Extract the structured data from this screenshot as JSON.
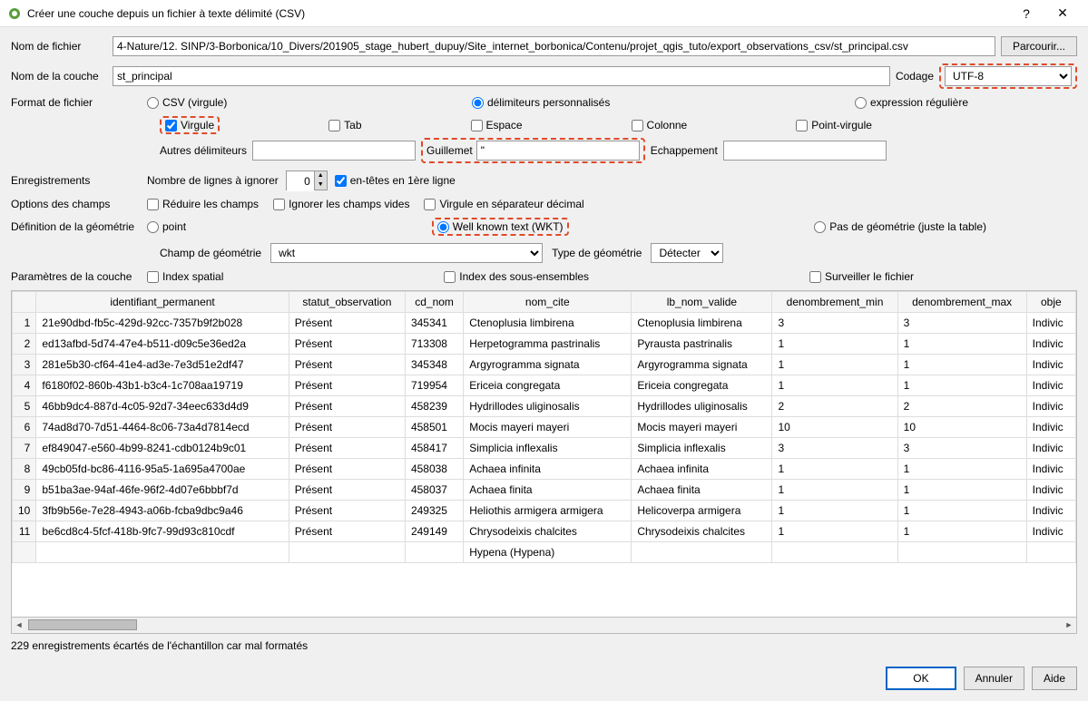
{
  "window": {
    "title": "Créer une couche depuis un fichier à texte délimité (CSV)"
  },
  "file": {
    "label": "Nom de fichier",
    "value": "4-Nature/12. SINP/3-Borbonica/10_Divers/201905_stage_hubert_dupuy/Site_internet_borbonica/Contenu/projet_qgis_tuto/export_observations_csv/st_principal.csv",
    "browse": "Parcourir..."
  },
  "layer": {
    "label": "Nom de la couche",
    "value": "st_principal",
    "encoding_label": "Codage",
    "encoding_value": "UTF-8"
  },
  "format": {
    "label": "Format de fichier",
    "csv": "CSV (virgule)",
    "custom": "délimiteurs personnalisés",
    "regex": "expression régulière"
  },
  "delim": {
    "virgule": "Virgule",
    "tab": "Tab",
    "espace": "Espace",
    "colonne": "Colonne",
    "pv": "Point-virgule",
    "autres": "Autres délimiteurs",
    "guillemet": "Guillemet",
    "guillemet_val": "\"",
    "echap": "Echappement"
  },
  "records": {
    "label": "Enregistrements",
    "skip": "Nombre de lignes à ignorer",
    "skip_val": "0",
    "header": "en-têtes en 1ère ligne"
  },
  "fields": {
    "label": "Options des champs",
    "trim": "Réduire les champs",
    "ignore_empty": "Ignorer les champs vides",
    "decimal": "Virgule en séparateur décimal"
  },
  "geom": {
    "label": "Définition de la géométrie",
    "point": "point",
    "wkt": "Well known text (WKT)",
    "none": "Pas de géométrie (juste la table)",
    "field_label": "Champ de géométrie",
    "field_val": "wkt",
    "type_label": "Type de géométrie",
    "type_val": "Détecter"
  },
  "params": {
    "label": "Paramètres de la couche",
    "spatial": "Index spatial",
    "subset": "Index des sous-ensembles",
    "watch": "Surveiller le fichier"
  },
  "table": {
    "headers": [
      "",
      "identifiant_permanent",
      "statut_observation",
      "cd_nom",
      "nom_cite",
      "lb_nom_valide",
      "denombrement_min",
      "denombrement_max",
      "obje"
    ],
    "rows": [
      [
        "1",
        "21e90dbd-fb5c-429d-92cc-7357b9f2b028",
        "Présent",
        "345341",
        "Ctenoplusia limbirena",
        "Ctenoplusia limbirena",
        "3",
        "3",
        "Indivic"
      ],
      [
        "2",
        "ed13afbd-5d74-47e4-b511-d09c5e36ed2a",
        "Présent",
        "713308",
        "Herpetogramma pastrinalis",
        "Pyrausta pastrinalis",
        "1",
        "1",
        "Indivic"
      ],
      [
        "3",
        "281e5b30-cf64-41e4-ad3e-7e3d51e2df47",
        "Présent",
        "345348",
        "Argyrogramma signata",
        "Argyrogramma signata",
        "1",
        "1",
        "Indivic"
      ],
      [
        "4",
        "f6180f02-860b-43b1-b3c4-1c708aa19719",
        "Présent",
        "719954",
        "Ericeia congregata",
        "Ericeia congregata",
        "1",
        "1",
        "Indivic"
      ],
      [
        "5",
        "46bb9dc4-887d-4c05-92d7-34eec633d4d9",
        "Présent",
        "458239",
        "Hydrillodes uliginosalis",
        "Hydrillodes uliginosalis",
        "2",
        "2",
        "Indivic"
      ],
      [
        "6",
        "74ad8d70-7d51-4464-8c06-73a4d7814ecd",
        "Présent",
        "458501",
        "Mocis mayeri mayeri",
        "Mocis mayeri mayeri",
        "10",
        "10",
        "Indivic"
      ],
      [
        "7",
        "ef849047-e560-4b99-8241-cdb0124b9c01",
        "Présent",
        "458417",
        "Simplicia inflexalis",
        "Simplicia inflexalis",
        "3",
        "3",
        "Indivic"
      ],
      [
        "8",
        "49cb05fd-bc86-4116-95a5-1a695a4700ae",
        "Présent",
        "458038",
        "Achaea infinita",
        "Achaea infinita",
        "1",
        "1",
        "Indivic"
      ],
      [
        "9",
        "b51ba3ae-94af-46fe-96f2-4d07e6bbbf7d",
        "Présent",
        "458037",
        "Achaea finita",
        "Achaea finita",
        "1",
        "1",
        "Indivic"
      ],
      [
        "10",
        "3fb9b56e-7e28-4943-a06b-fcba9dbc9a46",
        "Présent",
        "249325",
        "Heliothis armigera armigera",
        "Helicoverpa armigera",
        "1",
        "1",
        "Indivic"
      ],
      [
        "11",
        "be6cd8c4-5fcf-418b-9fc7-99d93c810cdf",
        "Présent",
        "249149",
        "Chrysodeixis chalcites",
        "Chrysodeixis chalcites",
        "1",
        "1",
        "Indivic"
      ],
      [
        "",
        "",
        "",
        "",
        "Hypena (Hypena)",
        "",
        "",
        "",
        ""
      ]
    ]
  },
  "status": "229 enregistrements écartés de l'échantillon car mal formatés",
  "buttons": {
    "ok": "OK",
    "cancel": "Annuler",
    "help": "Aide"
  }
}
